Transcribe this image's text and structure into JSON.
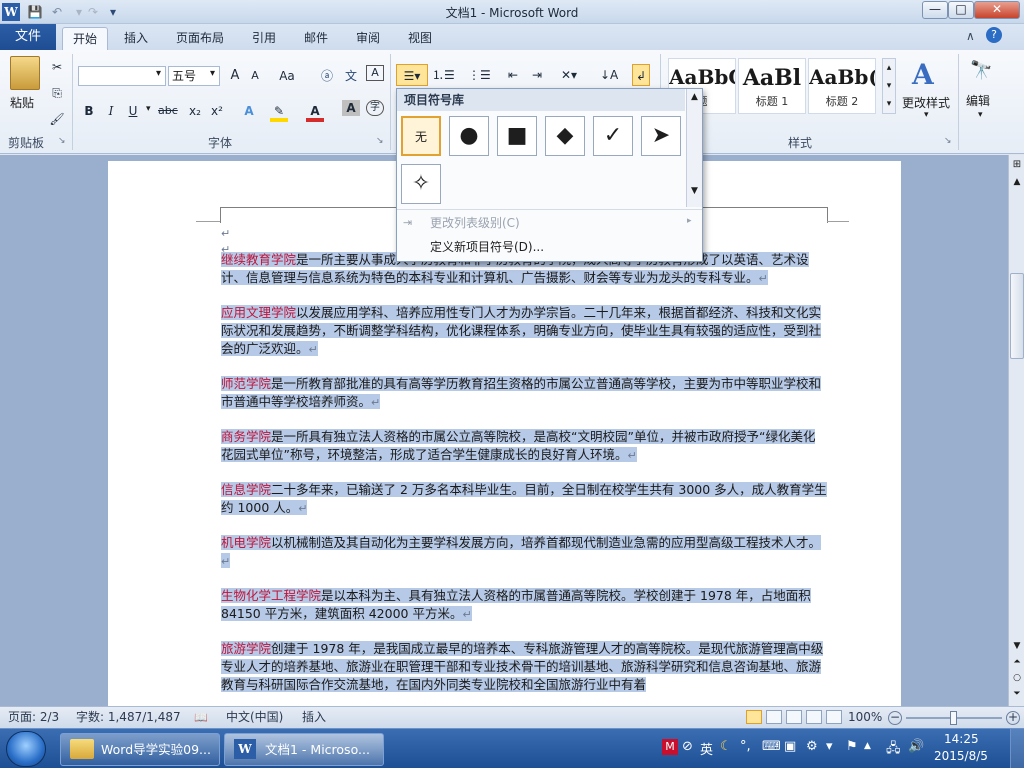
{
  "window": {
    "title": "文档1 - Microsoft Word"
  },
  "quick_access": {
    "save_icon": "save-icon",
    "undo_icon": "undo-icon",
    "redo_icon": "redo-icon"
  },
  "window_controls": {
    "minimize": "—",
    "maximize": "□",
    "close": "✕"
  },
  "tabs": {
    "file": "文件",
    "items": [
      "开始",
      "插入",
      "页面布局",
      "引用",
      "邮件",
      "审阅",
      "视图"
    ],
    "active": "开始"
  },
  "ribbon": {
    "clipboard": {
      "label": "剪贴板",
      "paste": "粘贴"
    },
    "font": {
      "label": "字体",
      "font_name": "",
      "font_size": "五号",
      "grow": "A",
      "shrink": "A",
      "case": "Aa",
      "bold": "B",
      "italic": "I",
      "underline": "U",
      "strike": "abc",
      "subscript": "x₂",
      "superscript": "x²",
      "highlight_color": "#ffd800",
      "font_color": "#d42b2b"
    },
    "styles": {
      "label": "样式",
      "items": [
        {
          "sample": "AaBbC",
          "name": "题"
        },
        {
          "sample": "AaBl",
          "name": "标题 1"
        },
        {
          "sample": "AaBb(",
          "name": "标题 2"
        }
      ],
      "change": "更改样式",
      "edit": "编辑"
    }
  },
  "bullet_dropdown": {
    "header": "项目符号库",
    "bullets": [
      {
        "glyph": "无",
        "name": "none"
      },
      {
        "glyph": "●",
        "name": "filled-circle"
      },
      {
        "glyph": "■",
        "name": "filled-square"
      },
      {
        "glyph": "◆",
        "name": "diamond"
      },
      {
        "glyph": "✓",
        "name": "checkmark"
      },
      {
        "glyph": "➤",
        "name": "arrow"
      },
      {
        "glyph": "✧",
        "name": "star"
      }
    ],
    "change_level": "更改列表级别(C)",
    "define_new": "定义新项目符号(D)..."
  },
  "document": {
    "paragraphs": [
      {
        "name": "继续教育学院",
        "text": "是一所主要从事成人学历教育和非学历教育的学院，成人高等学历教育形成了以英语、艺术设计、信息管理与信息系统为特色的本科专业和计算机、广告摄影、财会等专业为龙头的专科专业。"
      },
      {
        "name": "应用文理学院",
        "text": "以发展应用学科、培养应用性专门人才为办学宗旨。二十几年来，根据首都经济、科技和文化实际状况和发展趋势，不断调整学科结构，优化课程体系，明确专业方向，使毕业生具有较强的适应性，受到社会的广泛欢迎。"
      },
      {
        "name": "师范学院",
        "text": "是一所教育部批准的具有高等学历教育招生资格的市属公立普通高等学校，主要为市中等职业学校和市普通中等学校培养师资。"
      },
      {
        "name": "商务学院",
        "text": "是一所具有独立法人资格的市属公立高等院校，是高校“文明校园”单位，并被市政府授予“绿化美化花园式单位”称号，环境整洁，形成了适合学生健康成长的良好育人环境。"
      },
      {
        "name": "信息学院",
        "text": "二十多年来，已输送了 2 万多名本科毕业生。目前，全日制在校学生共有 3000 多人，成人教育学生约 1000 人。"
      },
      {
        "name": "机电学院",
        "text": "以机械制造及其自动化为主要学科发展方向，培养首都现代制造业急需的应用型高级工程技术人才。"
      },
      {
        "name": "生物化学工程学院",
        "text": "是以本科为主、具有独立法人资格的市属普通高等院校。学校创建于 1978 年，占地面积 84150 平方米，建筑面积 42000 平方米。"
      },
      {
        "name": "旅游学院",
        "text": "创建于 1978 年，是我国成立最早的培养本、专科旅游管理人才的高等院校。是现代旅游管理高中级专业人才的培养基地、旅游业在职管理干部和专业技术骨干的培训基地、旅游科学研究和信息咨询基地、旅游教育与科研国际合作交流基地，在国内外同类专业院校和全国旅游行业中有着"
      }
    ]
  },
  "status": {
    "page": "页面: 2/3",
    "words": "字数: 1,487/1,487",
    "language": "中文(中国)",
    "mode": "插入",
    "zoom": "100%"
  },
  "taskbar": {
    "items": [
      "Word导学实验09...",
      "文档1 - Microso..."
    ],
    "ime": "英",
    "time": "14:25",
    "date": "2015/8/5"
  },
  "colors": {
    "accent": "#2b5ea6",
    "selection": "#b6c9e6",
    "org_name": "#c0153b"
  }
}
